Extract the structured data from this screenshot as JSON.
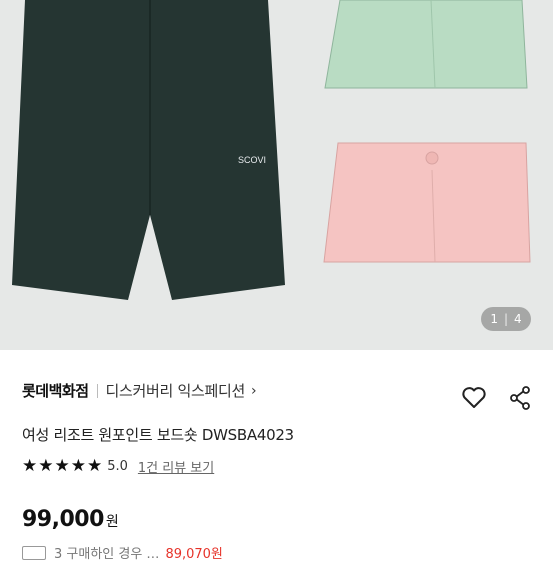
{
  "gallery": {
    "current": "1",
    "total": "4",
    "separator": "|",
    "shorts_label": "SCOVI",
    "colors": {
      "background": "#e6e8e7",
      "shorts_dark": "#253532",
      "shorts_green": "#b9dcc3",
      "shorts_pink": "#f5c4c2"
    }
  },
  "seller": {
    "store_name": "롯데백화점",
    "brand_name": "디스커버리 익스페디션"
  },
  "product": {
    "title": "여성 리조트 원포인트 보드숏 DWSBA4023",
    "rating_stars": "★★★★★",
    "rating_score": "5.0",
    "review_link": "1건 리뷰 보기",
    "price": "99,000",
    "price_unit": "원"
  },
  "coupon": {
    "text": "3 구매하인 경우 …",
    "amount": "89,070원"
  },
  "icons": {
    "heart": "heart-icon",
    "share": "share-icon",
    "chevron": "chevron-right-icon"
  }
}
